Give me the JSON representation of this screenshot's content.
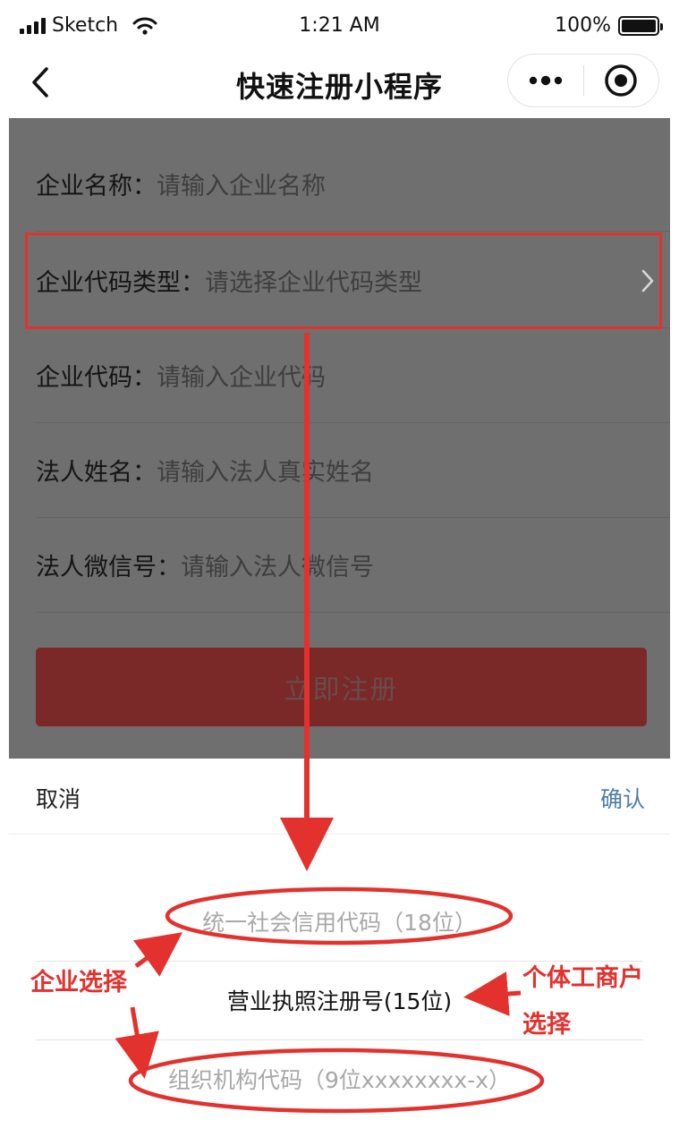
{
  "status_bar": {
    "carrier": "Sketch",
    "time": "1:21 AM",
    "battery": "100%"
  },
  "nav": {
    "title": "快速注册小程序",
    "back_icon": "chevron-left-icon",
    "more_icon": "more-dots-icon",
    "close_icon": "target-circle-icon"
  },
  "form": {
    "fields": [
      {
        "label": "企业名称：",
        "placeholder": "请输入企业名称"
      },
      {
        "label": "企业代码类型：",
        "placeholder": "请选择企业代码类型"
      },
      {
        "label": "企业代码：",
        "placeholder": "请输入企业代码"
      },
      {
        "label": "法人姓名：",
        "placeholder": "请输入法人真实姓名"
      },
      {
        "label": "法人微信号：",
        "placeholder": "请输入法人微信号"
      }
    ],
    "submit_label": "立即注册"
  },
  "picker": {
    "cancel_label": "取消",
    "confirm_label": "确认",
    "options": [
      "统一社会信用代码（18位）",
      "营业执照注册号(15位)",
      "组织机构代码（9位xxxxxxxx-x）"
    ],
    "selected_index": 1
  },
  "annotations": {
    "enterprise": "企业选择",
    "individual_line1": "个体工商户",
    "individual_line2": "选择"
  },
  "colors": {
    "accent": "#e3312d",
    "confirm": "#4d7da8",
    "overlay": "#6f6f6f",
    "button": "#7a2828"
  }
}
